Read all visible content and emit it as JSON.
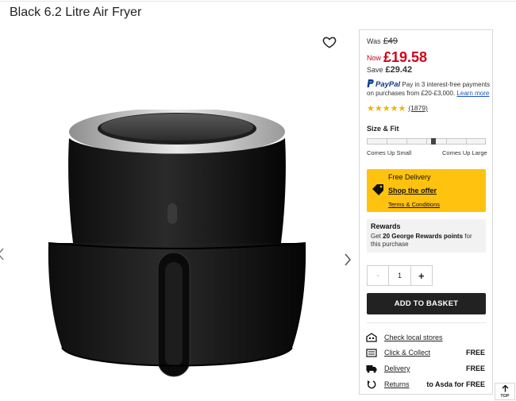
{
  "product": {
    "title": "Black 6.2 Litre Air Fryer"
  },
  "gallery": {
    "favourite_icon": "heart-outline-icon",
    "prev_icon": "chevron-left-icon",
    "next_icon": "chevron-right-icon"
  },
  "pricing": {
    "was_label": "Was",
    "was_price": "£49",
    "now_label": "Now",
    "now_price": "£19.58",
    "save_label": "Save",
    "save_amount": "£29.42",
    "price_color": "#d0021b"
  },
  "paypal": {
    "brand": "PayPal",
    "text": "Pay in 3 interest-free payments on purchases from £20-£3,000.",
    "link": "Learn more"
  },
  "rating": {
    "stars": 5,
    "count": "(1879)"
  },
  "size_fit": {
    "label": "Size & Fit",
    "min_label": "Comes Up Small",
    "max_label": "Comes Up Large",
    "position": 0.56
  },
  "delivery_offer": {
    "title": "Free Delivery",
    "link": "Shop the offer",
    "terms": "Terms & Conditions",
    "color": "#ffc20e"
  },
  "rewards": {
    "title": "Rewards",
    "text_before": "Get ",
    "points": "20 George Rewards points",
    "text_after": " for this purchase"
  },
  "quantity": {
    "minus": "-",
    "value": "1",
    "plus": "+"
  },
  "cart": {
    "add_label": "ADD TO BASKET"
  },
  "fulfilment": [
    {
      "icon": "store-icon",
      "label": "Check local stores",
      "value": ""
    },
    {
      "icon": "click-collect-icon",
      "label": "Click & Collect",
      "value": "FREE"
    },
    {
      "icon": "truck-icon",
      "label": "Delivery",
      "value": "FREE"
    },
    {
      "icon": "returns-icon",
      "label": "Returns",
      "value": "to Asda for FREE"
    }
  ],
  "scroll_top": {
    "label": "TOP"
  }
}
